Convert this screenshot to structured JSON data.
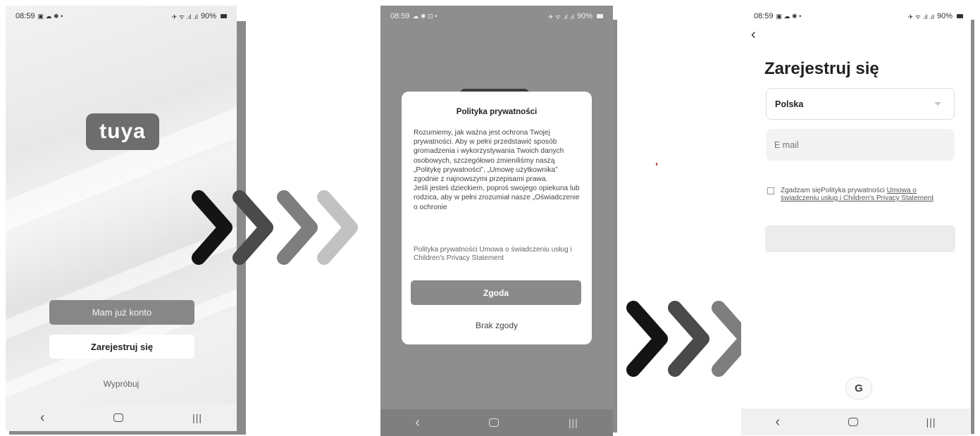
{
  "colors": {
    "arrow_1": "#141414",
    "arrow_2": "#4a4a4a",
    "arrow_3": "#7e7e7e",
    "arrow_4": "#c2c2c2"
  },
  "screen1": {
    "status": {
      "time": "08:59",
      "icons_left": "▣ ☁ ✱ •",
      "signal": "✈ ᯤ .ıl .ıl",
      "battery": "90%"
    },
    "logo_text": "tuya",
    "login_button": "Mam już konto",
    "register_button": "Zarejestruj się",
    "try_link": "Wypróbuj"
  },
  "screen2": {
    "status": {
      "time": "08:59",
      "icons_left": "☁ ✱ ⊡ •",
      "signal": "✈ ᯤ .ıl .ıl",
      "battery": "90%"
    },
    "dialog": {
      "title": "Polityka prywatności",
      "body": "Rozumiemy, jak ważna jest ochrona Twojej prywatności. Aby w pełni przedstawić sposób gromadzenia i wykorzystywania Twoich danych osobowych, szczegółowo zmieniliśmy naszą „Politykę prywatności”, „Umowę użytkownika” zgodnie z najnowszymi przepisami prawa.\nJeśli jesteś dzieckiem, poproś swojego opiekuna lub rodzica, aby w pełni zrozumiał nasze „Oświadczenie o ochronie",
      "links": "Polityka prywatności  Umowa o świadczeniu usług i Children's Privacy Statement",
      "agree_button": "Zgoda",
      "disagree_button": "Brak zgody"
    }
  },
  "screen3": {
    "status": {
      "time": "08:59",
      "icons_left": "▣ ☁ ✱ •",
      "signal": "✈ ᯤ .ıl .ıl",
      "battery": "90%"
    },
    "title": "Zarejestruj się",
    "country": "Polska",
    "email_placeholder": "E mail",
    "consent": {
      "prefix": "Zgadzam się",
      "privacy_policy": "Polityka prywatności",
      "service_agreement": "Umowa o świadczeniu usług i Children's Privacy Statement"
    },
    "google_label": "G"
  },
  "nav_icons": {
    "back": "back-icon",
    "home": "home-icon",
    "recents": "recents-icon"
  }
}
